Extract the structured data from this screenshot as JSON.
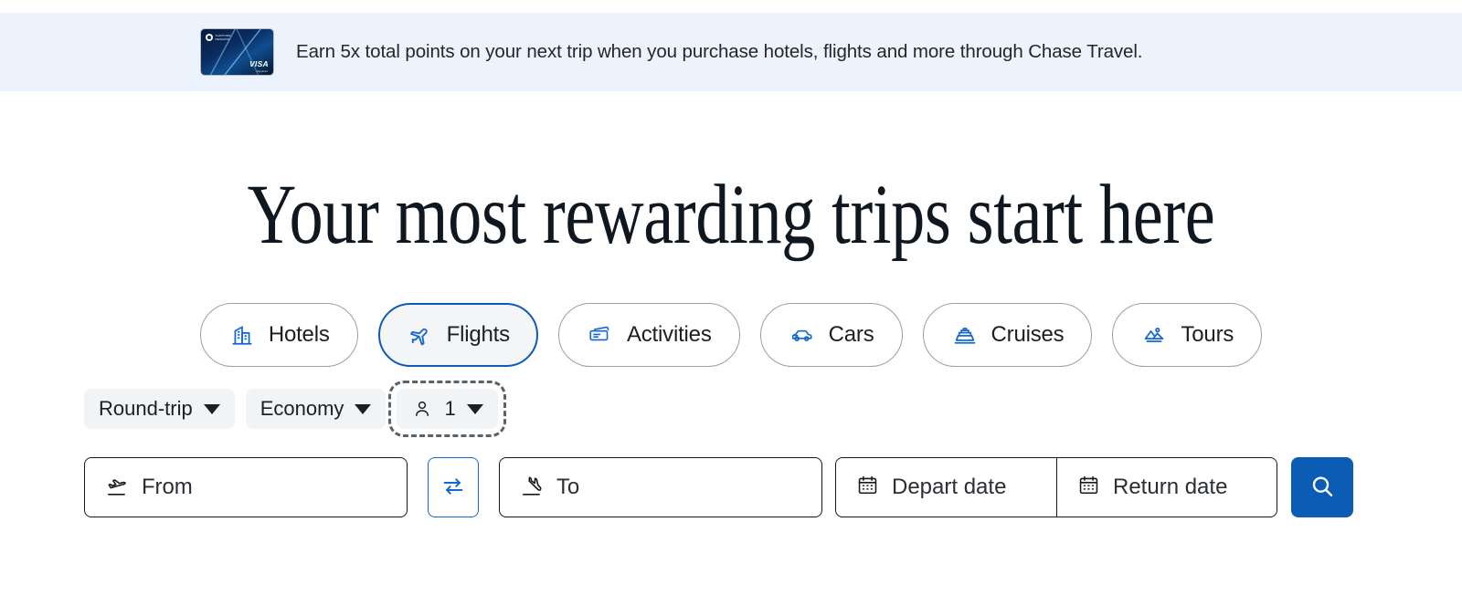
{
  "promo": {
    "card_icon": "chase-sapphire-card-icon",
    "card_brand_line1": "SAPPHIRE",
    "card_brand_line2": "RESERVE",
    "card_network": "VISA",
    "card_network_sub": "Signature",
    "message": "Earn 5x total points on your next trip when you purchase hotels, flights and more through Chase Travel.",
    "background_color": "#edf3fd"
  },
  "headline": "Your most rewarding trips start here",
  "tabs": [
    {
      "label": "Hotels",
      "icon": "hotel-building-icon",
      "selected": false
    },
    {
      "label": "Flights",
      "icon": "airplane-icon",
      "selected": true
    },
    {
      "label": "Activities",
      "icon": "tickets-icon",
      "selected": false
    },
    {
      "label": "Cars",
      "icon": "car-icon",
      "selected": false
    },
    {
      "label": "Cruises",
      "icon": "cruise-ship-icon",
      "selected": false
    },
    {
      "label": "Tours",
      "icon": "landscape-icon",
      "selected": false
    }
  ],
  "search": {
    "trip_type": {
      "label": "Round-trip",
      "icon": "chevron-down-icon"
    },
    "cabin_class": {
      "label": "Economy",
      "icon": "chevron-down-icon"
    },
    "travelers": {
      "count": "1",
      "icon": "person-icon",
      "caret": "chevron-down-icon",
      "focused": true
    },
    "origin": {
      "placeholder": "From",
      "value": "",
      "icon": "plane-takeoff-icon"
    },
    "swap": {
      "icon": "swap-arrows-icon",
      "label": ""
    },
    "destination": {
      "placeholder": "To",
      "value": "",
      "icon": "plane-landing-icon"
    },
    "depart_date": {
      "placeholder": "Depart date",
      "value": "",
      "icon": "calendar-icon"
    },
    "return_date": {
      "placeholder": "Return date",
      "value": "",
      "icon": "calendar-icon"
    },
    "submit": {
      "icon": "search-icon",
      "label": ""
    }
  },
  "colors": {
    "accent_blue": "#0b5cb5",
    "icon_blue": "#1467cf",
    "banner_bg": "#edf3fd",
    "pill_bg": "#f2f3f5",
    "text": "#1c1f22"
  }
}
